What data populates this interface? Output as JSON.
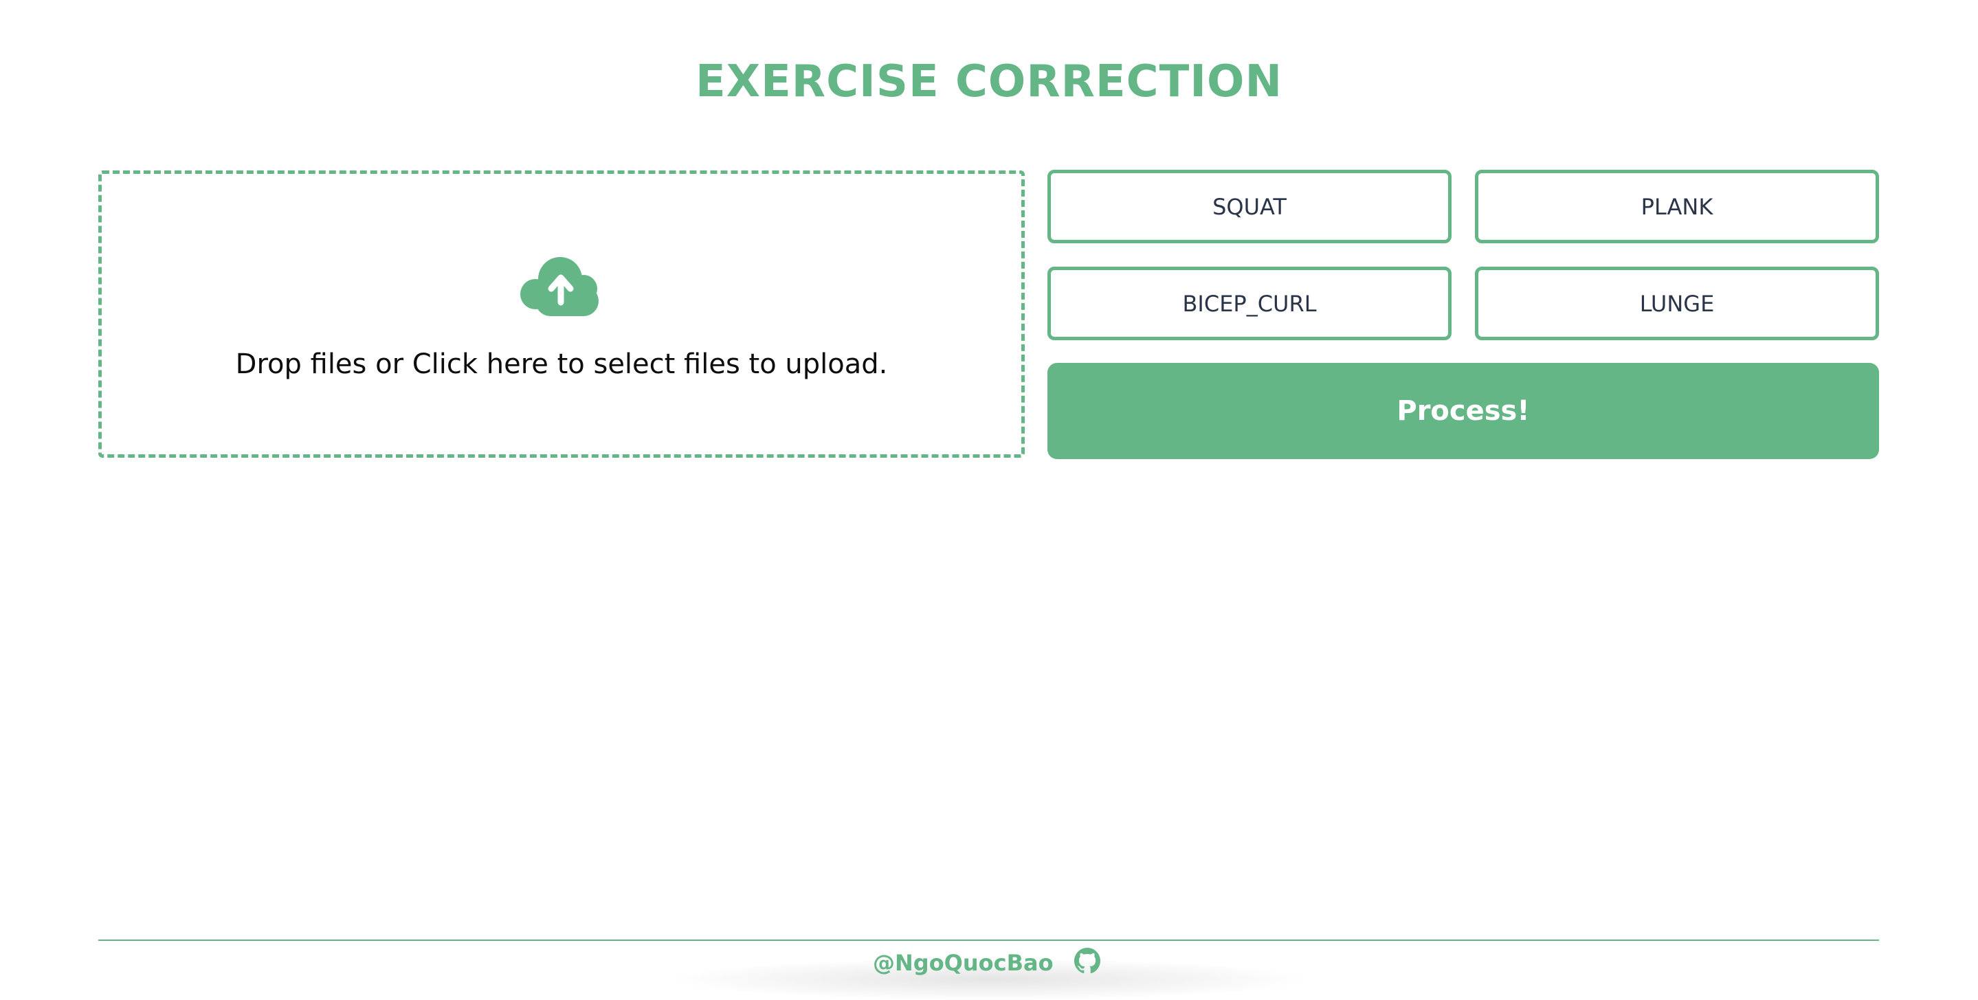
{
  "app": {
    "title": "EXERCISE CORRECTION"
  },
  "upload": {
    "icon": "cloud-upload-icon",
    "prompt": "Drop files or Click here to select files to upload."
  },
  "exercises": {
    "squat_label": "SQUAT",
    "plank_label": "PLANK",
    "bicep_curl_label": "BICEP_CURL",
    "lunge_label": "LUNGE"
  },
  "actions": {
    "process_label": "Process!"
  },
  "footer": {
    "author": "@NgoQuocBao",
    "icon": "github-icon"
  },
  "colors": {
    "accent": "#64b687",
    "button_text": "#2a3448",
    "body_text": "#0d0d0d",
    "background": "#ffffff"
  }
}
